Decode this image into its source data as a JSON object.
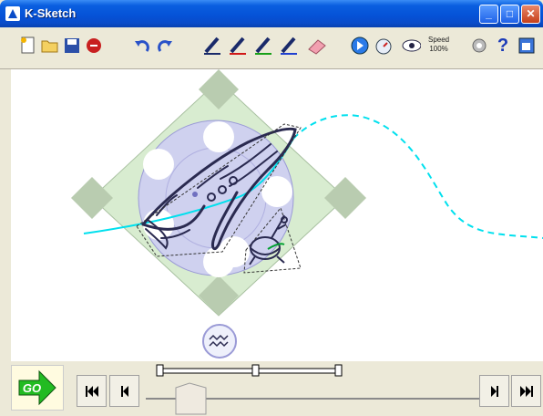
{
  "window": {
    "title": "K-Sketch",
    "minimize_glyph": "_",
    "maximize_glyph": "□",
    "close_glyph": "✕"
  },
  "toolbar": {
    "speed_label": "Speed",
    "speed_value": "100%",
    "help_glyph": "?",
    "icons": [
      "new-file-icon",
      "open-folder-icon",
      "save-disk-icon",
      "stop-record-icon",
      "undo-icon",
      "redo-icon",
      "pen-black-icon",
      "pen-red-icon",
      "pen-green-icon",
      "pen-blue-icon",
      "eraser-icon",
      "play-circle-icon",
      "timer-icon",
      "eye-view-icon",
      "speed-icon",
      "settings-gear-icon",
      "help-icon",
      "window-restore-icon"
    ]
  },
  "playback": {
    "go_label": "GO",
    "skip_start_glyph": "⏮",
    "step_back_glyph": "◀",
    "step_forward_glyph": "▶",
    "skip_end_glyph": "⏭"
  },
  "colors": {
    "path_dash": "#00e0ee",
    "selection_fill": "#d8ecd0",
    "handle_fill": "#b9ccb0",
    "rotation_circle": "#c8c8ee",
    "sketch_stroke": "#2a2a50",
    "go_green": "#22bb22"
  }
}
